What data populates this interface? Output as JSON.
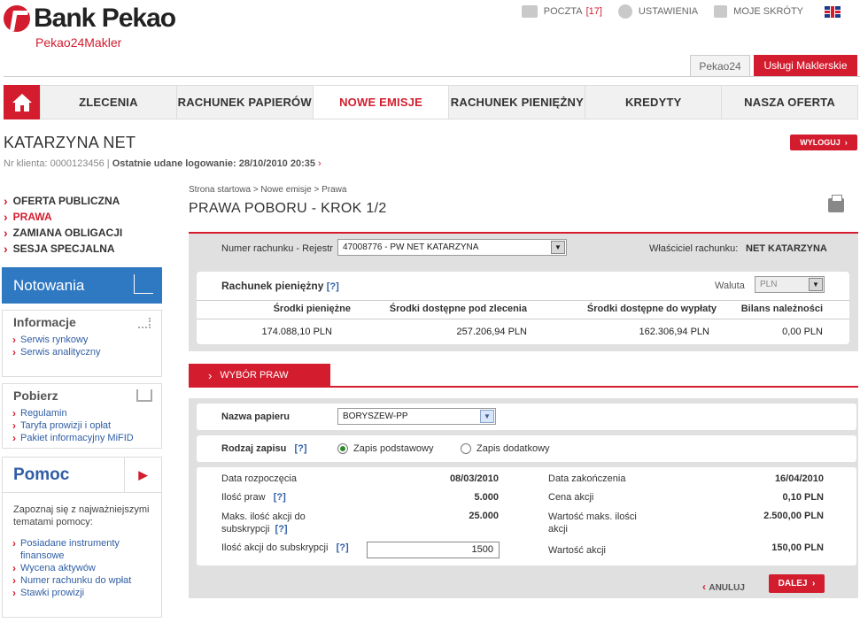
{
  "brand": {
    "name": "Bank Pekao",
    "sub": "Pekao24Makler"
  },
  "toplinks": {
    "mail": "POCZTA",
    "mail_count": "[17]",
    "settings": "USTAWIENIA",
    "shortcuts": "MOJE SKRÓTY"
  },
  "site_tabs": {
    "pekao24": "Pekao24",
    "brokerage": "Usługi Maklerskie"
  },
  "nav": [
    "ZLECENIA",
    "RACHUNEK PAPIERÓW",
    "NOWE EMISJE",
    "RACHUNEK PIENIĘŻNY",
    "KREDYTY",
    "NASZA OFERTA"
  ],
  "user": {
    "name": "KATARZYNA NET",
    "client_label": "Nr klienta: 0000123456",
    "last_login_label": "Ostatnie udane logowanie: 28/10/2010 20:35",
    "logout": "WYLOGUJ"
  },
  "sidemenu": [
    "OFERTA PUBLICZNA",
    "PRAWA",
    "ZAMIANA OBLIGACJI",
    "SESJA SPECJALNA"
  ],
  "notowania": "Notowania",
  "informacje": {
    "title": "Informacje",
    "links": [
      "Serwis rynkowy",
      "Serwis analityczny"
    ]
  },
  "pobierz": {
    "title": "Pobierz",
    "links": [
      "Regulamin",
      "Taryfa prowizji i opłat",
      "Pakiet informacyjny MiFID"
    ]
  },
  "pomoc": {
    "title": "Pomoc",
    "desc": "Zapoznaj się z najważniejszymi tematami pomocy:",
    "links": [
      "Posiadane instrumenty finansowe",
      "Wycena aktywów",
      "Numer rachunku do wpłat",
      "Stawki prowizji"
    ]
  },
  "breadcrumb": "Strona startowa > Nowe emisje > Prawa",
  "page_title": "PRAWA POBORU - KROK 1/2",
  "account": {
    "label": "Numer rachunku - Rejestr",
    "value": "47008776 - PW NET KATARZYNA",
    "owner_label": "Właściciel rachunku:",
    "owner": "NET KATARZYNA"
  },
  "cash": {
    "title": "Rachunek pieniężny",
    "help": "[?]",
    "currency_label": "Waluta",
    "currency": "PLN",
    "headers": [
      "Środki pieniężne",
      "Środki dostępne pod zlecenia",
      "Środki dostępne do wypłaty",
      "Bilans należności"
    ],
    "values": [
      "174.088,10  PLN",
      "257.206,94  PLN",
      "162.306,94  PLN",
      "0,00  PLN"
    ]
  },
  "wybor_tab": "WYBÓR PRAW",
  "form": {
    "paper_label": "Nazwa papieru",
    "paper_value": "BORYSZEW-PP",
    "type_label": "Rodzaj zapisu",
    "type_help": "[?]",
    "option_basic": "Zapis podstawowy",
    "option_extra": "Zapis dodatkowy",
    "start_label": "Data rozpoczęcia",
    "start_value": "08/03/2010",
    "end_label": "Data zakończenia",
    "end_value": "16/04/2010",
    "rights_label": "Ilość praw",
    "rights_help": "[?]",
    "rights_value": "5.000",
    "price_label": "Cena akcji",
    "price_value": "0,10 PLN",
    "max_label": "Maks. ilość akcji do subskrypcji",
    "max_help": "[?]",
    "max_value": "25.000",
    "maxval_label": "Wartość maks. ilości akcji",
    "maxval_value": "2.500,00 PLN",
    "qty_label": "Ilość akcji do subskrypcji",
    "qty_help": "[?]",
    "qty_value": "1500",
    "sharesval_label": "Wartość akcji",
    "sharesval_value": "150,00 PLN"
  },
  "buttons": {
    "cancel": "ANULUJ",
    "next": "DALEJ"
  }
}
